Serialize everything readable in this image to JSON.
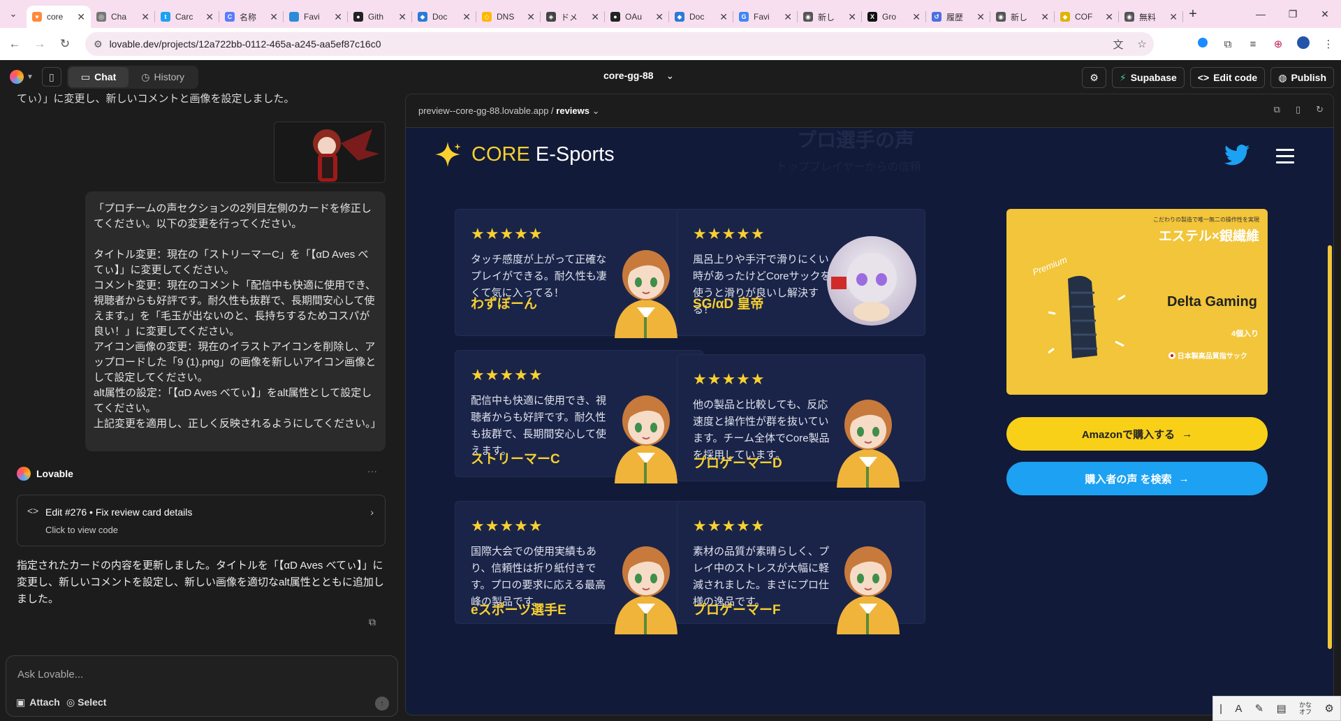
{
  "browser": {
    "tabs": [
      {
        "title": "core",
        "color": "#ff8a3c",
        "glyph": "♥",
        "active": true
      },
      {
        "title": "Cha",
        "color": "#777",
        "glyph": "◎"
      },
      {
        "title": "Carc",
        "color": "#1da1f2",
        "glyph": "t"
      },
      {
        "title": "名称",
        "color": "#5a7cff",
        "glyph": "C"
      },
      {
        "title": "Favi",
        "color": "#2c8bd8",
        "glyph": ""
      },
      {
        "title": "Gith",
        "color": "#222",
        "glyph": "●"
      },
      {
        "title": "Doc",
        "color": "#2b7ad6",
        "glyph": "◆"
      },
      {
        "title": "DNS",
        "color": "#ffb800",
        "glyph": "◇"
      },
      {
        "title": "ドメ",
        "color": "#444",
        "glyph": "◈"
      },
      {
        "title": "OAu",
        "color": "#222",
        "glyph": "●"
      },
      {
        "title": "Doc",
        "color": "#2b7ad6",
        "glyph": "◆"
      },
      {
        "title": "Favi",
        "color": "#4285f4",
        "glyph": "G"
      },
      {
        "title": "新し",
        "color": "#555",
        "glyph": "◉"
      },
      {
        "title": "Gro",
        "color": "#111",
        "glyph": "X"
      },
      {
        "title": "履歴",
        "color": "#4a6fe0",
        "glyph": "↺"
      },
      {
        "title": "新し",
        "color": "#555",
        "glyph": "◉"
      },
      {
        "title": "COF",
        "color": "#e0b400",
        "glyph": "◆"
      },
      {
        "title": "無料",
        "color": "#555",
        "glyph": "◉"
      }
    ],
    "url": "lovable.dev/projects/12a722bb-0112-465a-a245-aa5ef87c16c0"
  },
  "lovable": {
    "chat_tab": "Chat",
    "history_tab": "History",
    "project_name": "core-gg-88",
    "supabase": "Supabase",
    "edit_code": "Edit code",
    "publish": "Publish",
    "msg_top": "てぃ）」に変更し、新しいコメントと画像を設定しました。",
    "user_bubble": "「プロチームの声セクションの2列目左側のカードを修正してください。以下の変更を行ってください。\n\nタイトル変更：現在の「ストリーマーC」を「【αD Aves べてぃ】」に変更してください。\nコメント変更：現在のコメント「配信中も快適に使用でき、視聴者からも好評です。耐久性も抜群で、長期間安心して使えます。」を「毛玉が出ないのと、長持ちするためコスパが良い！」に変更してください。\nアイコン画像の変更：現在のイラストアイコンを削除し、アップロードした「9 (1).png」の画像を新しいアイコン画像として設定してください。\nalt属性の設定：「【αD Aves べてぃ】」をalt属性として設定してください。\n上記変更を適用し、正しく反映されるようにしてください。」",
    "assistant_name": "Lovable",
    "edit_title": "Edit #276 • Fix review card details",
    "edit_sub": "Click to view code",
    "assistant_reply": "指定されたカードの内容を更新しました。タイトルを「【αD Aves べてぃ】」に変更し、新しいコメントを設定し、新しい画像を適切なalt属性とともに追加しました。",
    "input_placeholder": "Ask Lovable...",
    "attach": "Attach",
    "select": "Select"
  },
  "preview": {
    "host": "preview--core-gg-88.lovable.app",
    "path": "reviews",
    "ghost_title": "プロ選手の声",
    "ghost_sub": "トッププレイヤーからの信頼"
  },
  "site": {
    "brand_core": "CORE",
    "brand_rest": " E-Sports",
    "stars": "★★★★★",
    "reviews": [
      {
        "text": "タッチ感度が上がって正確なプレイができる。耐久性も凄くて気に入ってる！",
        "name": "わずぼーん"
      },
      {
        "text": "風呂上りや手汗で滑りにくい時があったけどCoreサックを使うと滑りが良いし解決する！",
        "name": "SG/αD 皇帝"
      },
      {
        "text": "配信中も快適に使用でき、視聴者からも好評です。耐久性も抜群で、長期間安心して使えます。",
        "name": "ストリーマーC"
      },
      {
        "text": "他の製品と比較しても、反応速度と操作性が群を抜いています。チーム全体でCore製品を採用しています。",
        "name": "プロゲーマーD"
      },
      {
        "text": "国際大会での使用実績もあり、信頼性は折り紙付きです。プロの要求に応える最高峰の製品です。",
        "name": "eスポーツ選手E"
      },
      {
        "text": "素材の品質が素晴らしく、プレイ中のストレスが大幅に軽減されました。まさにプロ仕様の逸品です。",
        "name": "プロゲーマーF"
      }
    ],
    "product": {
      "tagline": "こだわりの製造で唯一無二の操作性を実現",
      "material": "エステル×銀繊維",
      "premium": "Premium",
      "brand": "Delta Gaming",
      "count": "4個入り",
      "origin": "日本製高品質指サック"
    },
    "amazon_btn": "Amazonで購入する",
    "review_btn": "購入者の声 を検索"
  },
  "ime": {
    "kana": "かな\nオフ"
  }
}
